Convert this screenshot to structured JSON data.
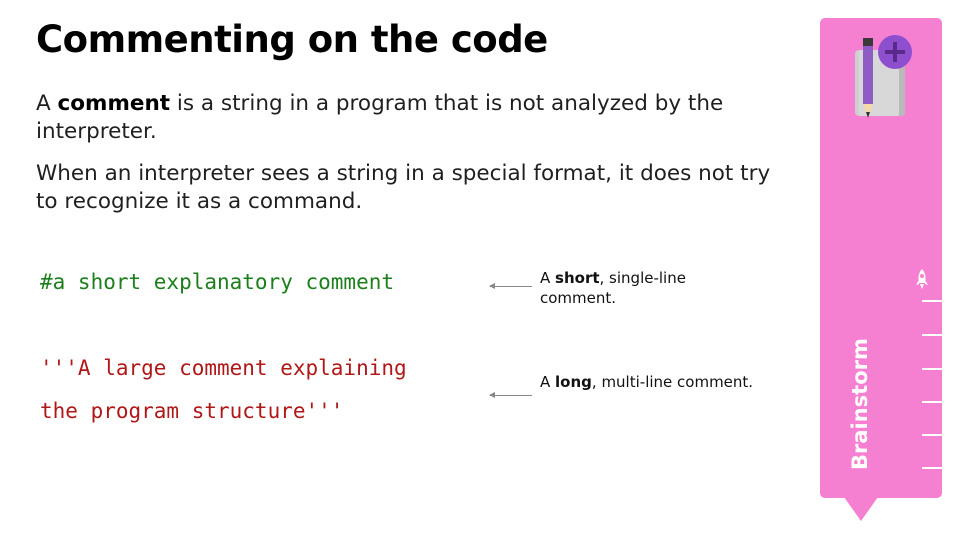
{
  "title": "Commenting on the code",
  "para1": {
    "prefix": "A ",
    "bold": "comment",
    "suffix": " is a string in a program that is not analyzed by the interpreter."
  },
  "para2": "When an interpreter sees a string in a special format, it does not try to recognize it as a command.",
  "code": {
    "line1": "#a short explanatory comment",
    "line2": "'''A large comment explaining",
    "line3": "the program structure'''"
  },
  "notes": {
    "short": {
      "prefix": "A ",
      "bold": "short",
      "suffix": ", single-line comment."
    },
    "long": {
      "prefix": "A ",
      "bold": "long",
      "suffix": ", multi-line comment."
    }
  },
  "sidebar": {
    "label": "Brainstorm",
    "icon": "notebook-pencil-plus-icon",
    "progress_icon": "rocket-icon",
    "color": "#f57fd0"
  },
  "colors": {
    "code_single_line": "#1b7f1b",
    "code_multi_line": "#b01818"
  }
}
